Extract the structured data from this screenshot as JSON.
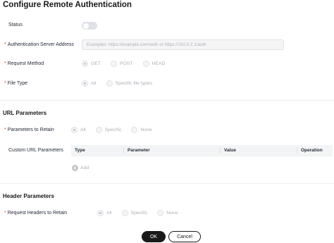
{
  "title": "Configure Remote Authentication",
  "status": {
    "label": "Status",
    "enabled": false
  },
  "auth_server": {
    "label": "Authentication Server Address",
    "placeholder": "Examples: https://example.com/auth or https://192.0.2.1/auth",
    "value": ""
  },
  "request_method": {
    "label": "Request Method",
    "options": [
      "GET",
      "POST",
      "HEAD"
    ],
    "selected": "GET"
  },
  "file_type": {
    "label": "File Type",
    "options": [
      "All",
      "Specific file types"
    ],
    "selected": "All"
  },
  "url_params": {
    "section_title": "URL Parameters",
    "retain_label": "Parameters to Retain",
    "retain_options": [
      "All",
      "Specific",
      "None"
    ],
    "retain_selected": "All",
    "custom_label": "Custom URL Parameters",
    "columns": [
      "Type",
      "Parameter",
      "Value",
      "Operation"
    ],
    "rows": [],
    "add_label": "Add"
  },
  "header_params": {
    "section_title": "Header Parameters",
    "retain_label": "Request Headers to Retain",
    "retain_options": [
      "All",
      "Specific",
      "None"
    ],
    "retain_selected": "All"
  },
  "buttons": {
    "ok": "OK",
    "cancel": "Cancel"
  },
  "colors": {
    "required": "#e62e3d",
    "primary_button": "#191919",
    "disabled_text": "#adb0b8"
  }
}
